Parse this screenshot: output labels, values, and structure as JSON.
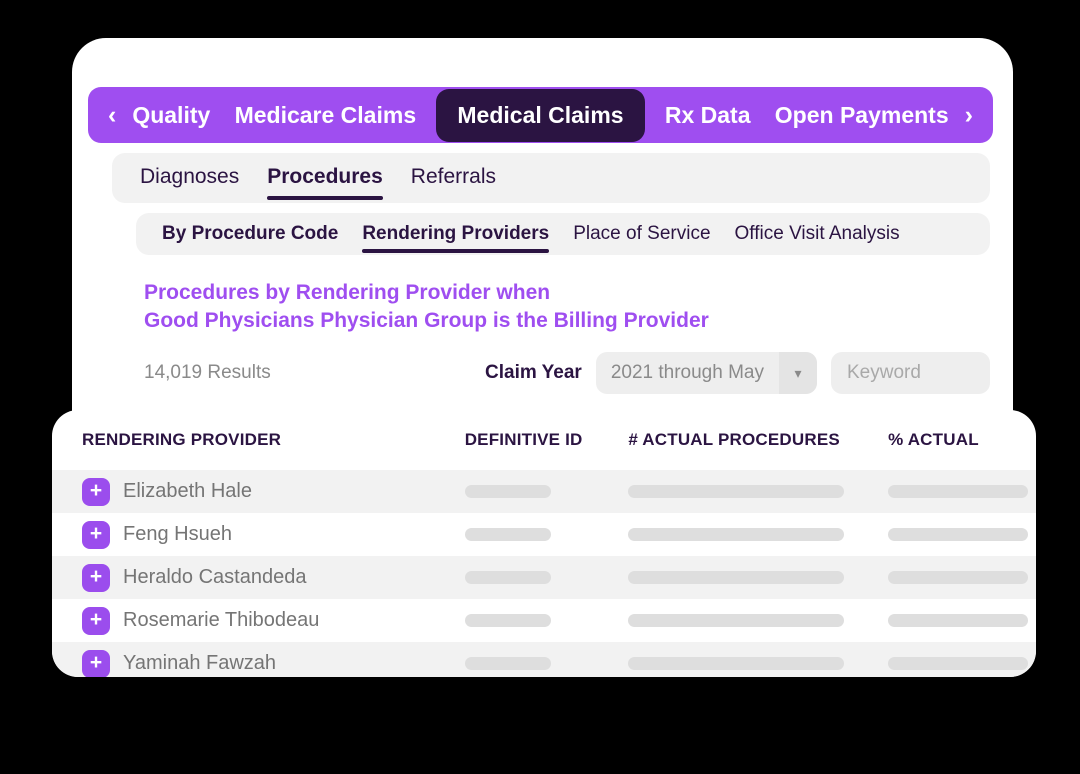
{
  "nav": {
    "prev_icon": "chevron-left-icon",
    "next_icon": "chevron-right-icon",
    "prev_glyph": "‹",
    "next_glyph": "›",
    "items": [
      {
        "label": "Quality",
        "active": false
      },
      {
        "label": "Medicare Claims",
        "active": false
      },
      {
        "label": "Medical Claims",
        "active": true
      },
      {
        "label": "Rx Data",
        "active": false
      },
      {
        "label": "Open Payments",
        "active": false
      }
    ],
    "bar_color": "#9f4ef0",
    "active_color": "#2b1442"
  },
  "tabs_primary": [
    {
      "label": "Diagnoses",
      "active": false
    },
    {
      "label": "Procedures",
      "active": true
    },
    {
      "label": "Referrals",
      "active": false
    }
  ],
  "tabs_secondary": [
    {
      "label": "By Procedure Code",
      "active": false,
      "bold": true
    },
    {
      "label": "Rendering Providers",
      "active": true,
      "bold": true
    },
    {
      "label": "Place of Service",
      "active": false,
      "bold": false
    },
    {
      "label": "Office Visit Analysis",
      "active": false,
      "bold": false
    }
  ],
  "heading": {
    "line1": "Procedures by Rendering Provider when",
    "line2": "Good Physicians Physician Group is the Billing Provider",
    "color": "#9f4ef0"
  },
  "filters": {
    "results_count": "14,019 Results",
    "claim_year_label": "Claim Year",
    "claim_year_value": "2021 through May",
    "caret_icon": "chevron-down-icon",
    "caret_glyph": "▾",
    "keyword_placeholder": "Keyword",
    "keyword_value": ""
  },
  "table": {
    "columns": [
      "RENDERING PROVIDER",
      "DEFINITIVE ID",
      "# ACTUAL PROCEDURES",
      "% ACTUAL"
    ],
    "rows": [
      {
        "name": "Elizabeth Hale",
        "expand_icon": "plus-icon",
        "expand_glyph": "+"
      },
      {
        "name": "Feng Hsueh",
        "expand_icon": "plus-icon",
        "expand_glyph": "+"
      },
      {
        "name": "Heraldo Castandeda",
        "expand_icon": "plus-icon",
        "expand_glyph": "+"
      },
      {
        "name": "Rosemarie Thibodeau",
        "expand_icon": "plus-icon",
        "expand_glyph": "+"
      },
      {
        "name": "Yaminah Fawzah",
        "expand_icon": "plus-icon",
        "expand_glyph": "+"
      }
    ],
    "accent_color": "#9b4ded"
  }
}
